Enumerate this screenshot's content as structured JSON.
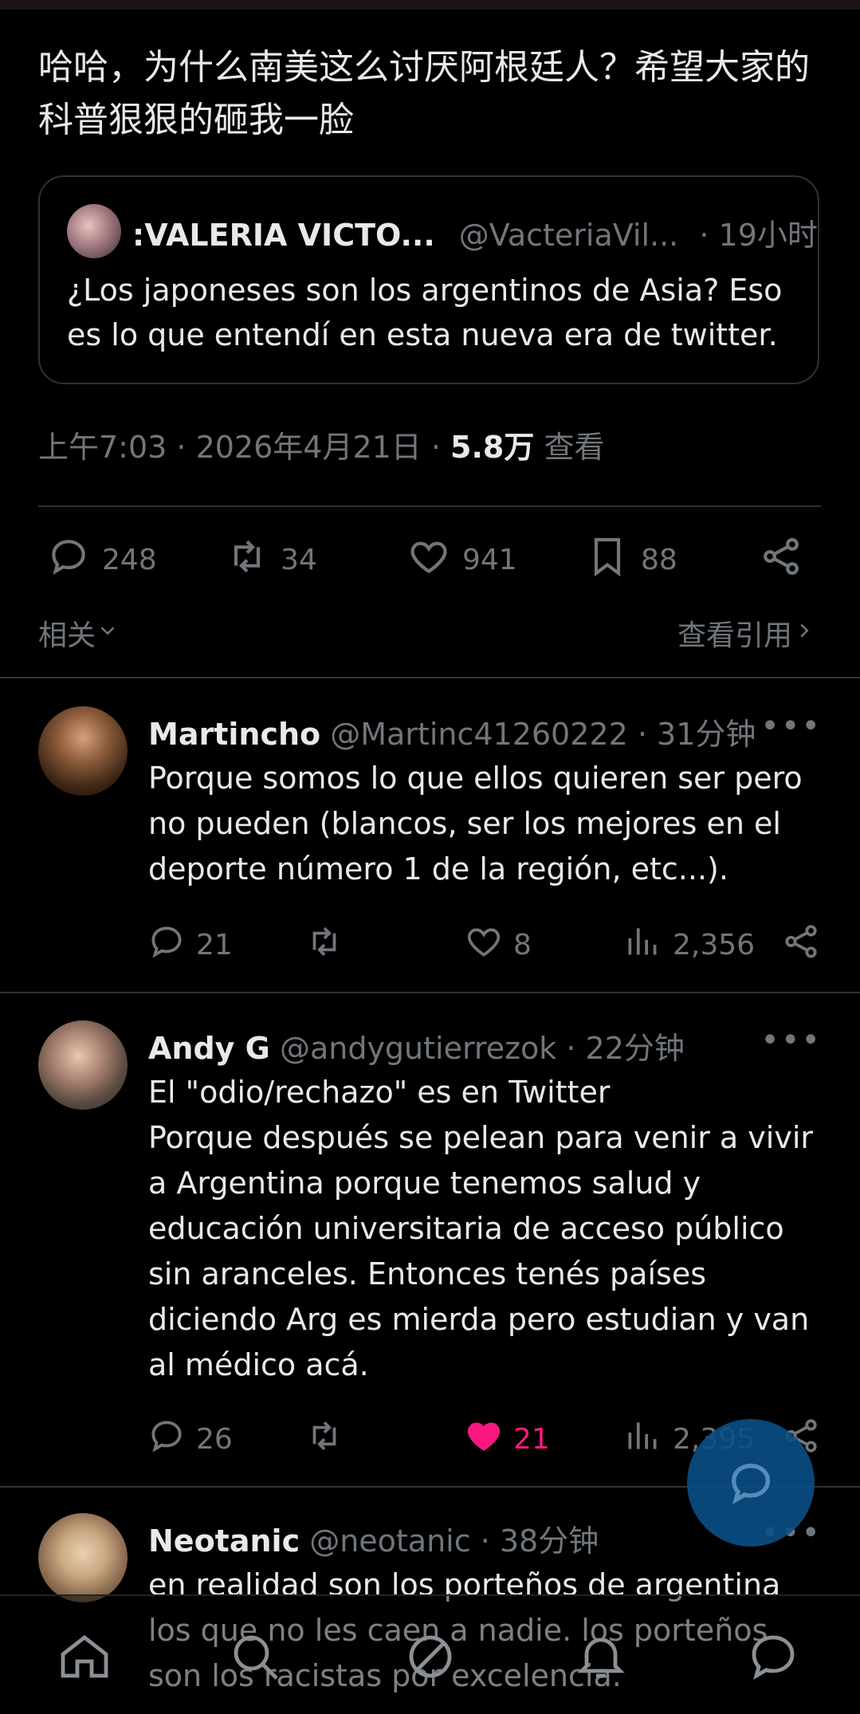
{
  "post": {
    "text": "哈哈，为什么南美这么讨厌阿根廷人？希望大家的科普狠狠的砸我一脸",
    "quote": {
      "name": ":VALERIA VICTO...",
      "handle": "@VacteriaVil...",
      "time": "· 19小时",
      "text": "¿Los japoneses son los argentinos de Asia? Eso es lo que entendí en esta nueva era de twitter."
    },
    "meta": {
      "time_date": "上午7:03 · 2026年4月21日 · ",
      "views": "5.8万",
      "views_label": " 查看"
    },
    "actions": {
      "replies": "248",
      "retweets": "34",
      "likes": "941",
      "bookmarks": "88"
    },
    "related_label": "相关",
    "view_quotes_label": "查看引用"
  },
  "replies": [
    {
      "name": "Martincho",
      "handle": "@Martinc41260222",
      "time": "· 31分钟",
      "text": "Porque somos lo que ellos quieren ser pero no pueden (blancos, ser los mejores en el deporte número 1 de la región, etc...).",
      "replies": "21",
      "likes": "8",
      "views": "2,356",
      "liked": false
    },
    {
      "name": "Andy G",
      "handle": "@andygutierrezok",
      "time": "· 22分钟",
      "text": "El \"odio/rechazo\" es en Twitter\nPorque después se pelean para venir a vivir a Argentina porque tenemos salud y educación universitaria de acceso público sin aranceles. Entonces tenés países diciendo Arg es mierda pero estudian y van al médico acá.",
      "replies": "26",
      "likes": "21",
      "views": "2,395",
      "liked": true
    },
    {
      "name": "Neotanic",
      "handle": "@neotanic",
      "time": "· 38分钟",
      "text": "en realidad son los porteños de argentina los que no les caen a nadie. los porteños son los racistas por excelencia."
    }
  ],
  "colors": {
    "background": "#000000",
    "text": "#e7e9ea",
    "muted": "#71767b",
    "like": "#f91880",
    "fab": "#0b4f86"
  }
}
